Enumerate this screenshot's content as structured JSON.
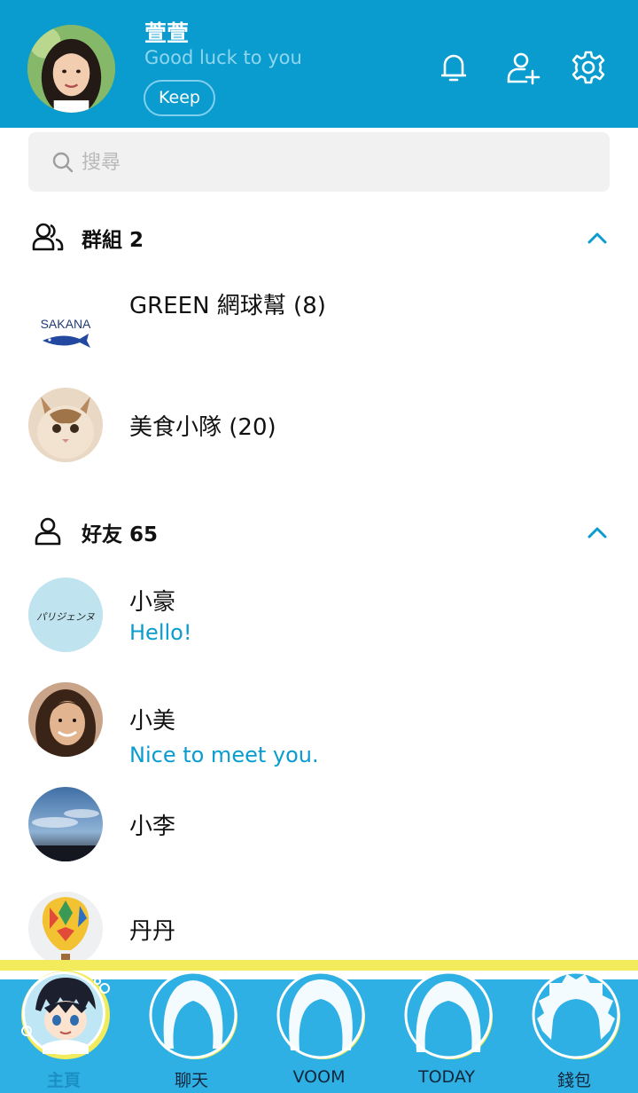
{
  "profile": {
    "name": "萱萱",
    "status": "Good luck to you",
    "keep_label": "Keep"
  },
  "header_icons": [
    "bell-icon",
    "add-friend-icon",
    "gear-icon"
  ],
  "search": {
    "placeholder": "搜尋",
    "value": ""
  },
  "groups": {
    "title": "群組 2",
    "items": [
      {
        "name": "GREEN 網球幫 (8)",
        "logo_text": "SAKANA"
      },
      {
        "name": "美食小隊 (20)"
      }
    ]
  },
  "friends": {
    "title": "好友 65",
    "items": [
      {
        "name": "小豪",
        "message": "Hello!",
        "avatar_text": "パリジェンヌ"
      },
      {
        "name": "小美",
        "message": "Nice to meet you."
      },
      {
        "name": "小李",
        "message": ""
      },
      {
        "name": "丹丹",
        "message": ""
      }
    ]
  },
  "bottom_nav": {
    "items": [
      {
        "label": "主頁",
        "active": true
      },
      {
        "label": "聊天",
        "active": false
      },
      {
        "label": "VOOM",
        "active": false
      },
      {
        "label": "TODAY",
        "active": false
      },
      {
        "label": "錢包",
        "active": false
      }
    ]
  },
  "colors": {
    "header": "#0a9ccf",
    "accent": "#0a9ccf",
    "nav": "#2fb0e4",
    "nav_stripe": "#f2ec5c"
  }
}
